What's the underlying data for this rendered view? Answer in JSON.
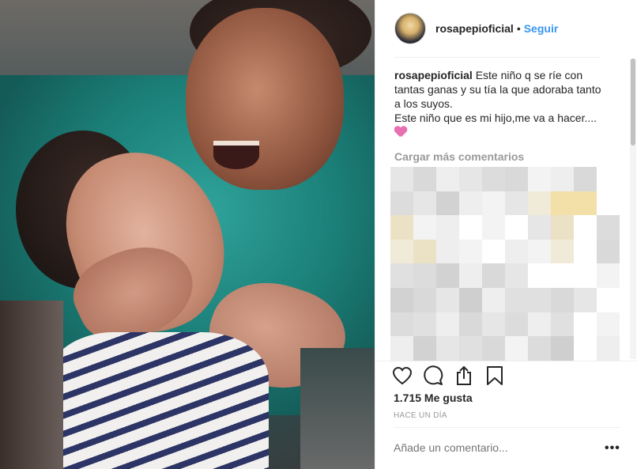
{
  "header": {
    "username": "rosapepioficial",
    "separator": "•",
    "follow_label": "Seguir"
  },
  "caption": {
    "username": "rosapepioficial",
    "text_line1": "Este niño q se ríe con tantas ganas y su tía la que adoraba tanto a los suyos.",
    "text_line2": "Este niño que es mi hijo,me va a hacer....",
    "emoji": "sparkling-heart-emoji"
  },
  "comments": {
    "load_more_label": "Cargar más comentarios"
  },
  "actions": {
    "like_icon": "heart-outline-icon",
    "comment_icon": "comment-bubble-icon",
    "share_icon": "share-icon",
    "save_icon": "bookmark-icon"
  },
  "stats": {
    "likes_text": "1.715 Me gusta",
    "time_text": "HACE UN DÍA"
  },
  "comment_box": {
    "placeholder": "Añade un comentario...",
    "more_label": "•••"
  },
  "colors": {
    "link_blue": "#3897f0",
    "muted": "#999999",
    "text": "#262626"
  }
}
